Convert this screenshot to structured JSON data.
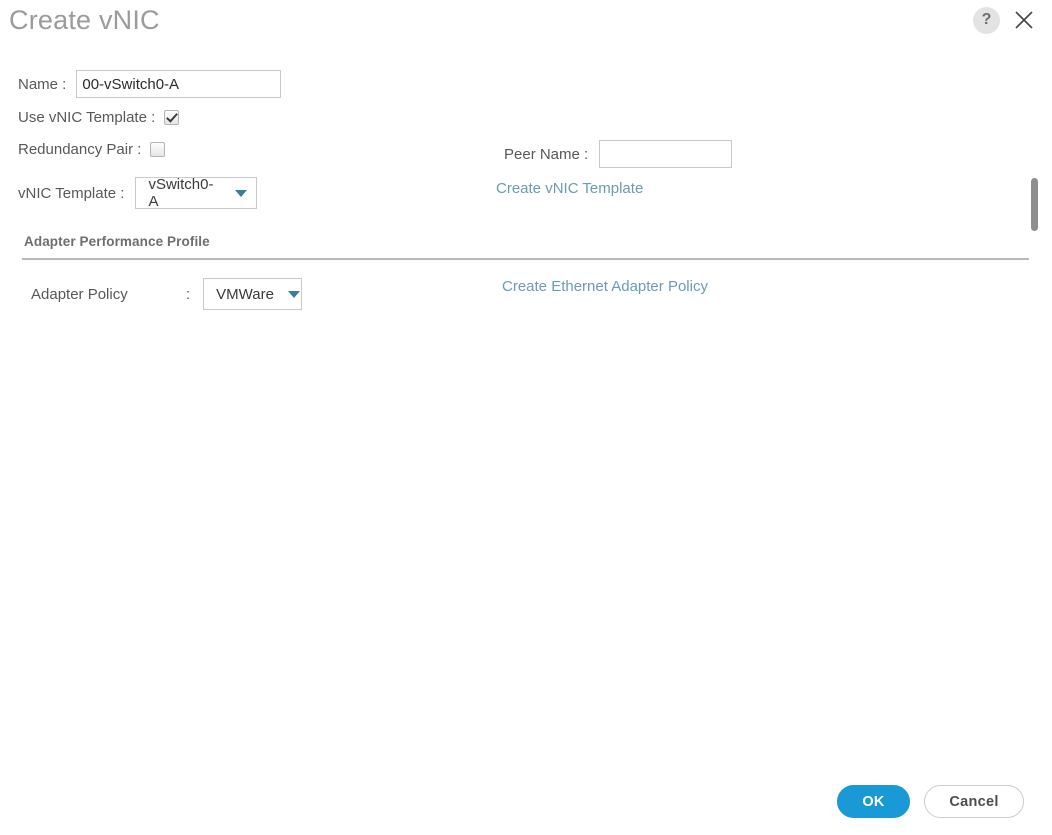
{
  "dialog": {
    "title": "Create vNIC",
    "help_icon_label": "?",
    "close_icon_label": "✕"
  },
  "form": {
    "name": {
      "label": "Name :",
      "value": "00-vSwitch0-A",
      "placeholder": ""
    },
    "use_vnic_template": {
      "label": "Use vNIC Template :",
      "checked": true
    },
    "redundancy_pair": {
      "label": "Redundancy Pair :",
      "checked": false
    },
    "peer_name": {
      "label": "Peer Name :",
      "value": "",
      "placeholder": ""
    },
    "vnic_template": {
      "label": "vNIC Template :",
      "selected": "vSwitch0-A"
    },
    "create_vnic_template_link": "Create vNIC Template"
  },
  "adapter_section": {
    "title": "Adapter Performance Profile",
    "adapter_policy": {
      "label": "Adapter Policy",
      "colon": ":",
      "selected": "VMWare"
    },
    "create_ethernet_adapter_policy_link": "Create Ethernet Adapter Policy"
  },
  "footer": {
    "ok_label": "OK",
    "cancel_label": "Cancel"
  },
  "colors": {
    "accent_blue": "#199ad6",
    "link_blue": "#6b9cb0",
    "caret_teal": "#3c7c96",
    "title_gray": "#9b9b9e",
    "label_gray": "#58585b",
    "rule_gray": "#b9b9b9",
    "scrollbar_gray": "#8e8e8e"
  }
}
